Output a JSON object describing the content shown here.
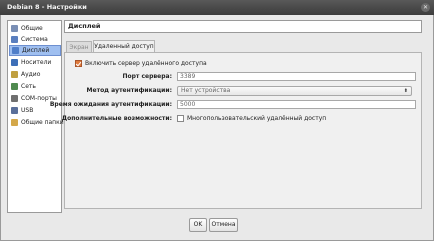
{
  "window": {
    "title": "Debian 8 - Настройки"
  },
  "sidebar": {
    "items": [
      {
        "label": "Общие",
        "icon": "general-icon",
        "color": "#7a8fb5"
      },
      {
        "label": "Система",
        "icon": "system-icon",
        "color": "#5a7fbf"
      },
      {
        "label": "Дисплей",
        "icon": "display-icon",
        "color": "#4f7ec9",
        "active": true
      },
      {
        "label": "Носители",
        "icon": "storage-icon",
        "color": "#3d6fb8"
      },
      {
        "label": "Аудио",
        "icon": "audio-icon",
        "color": "#c0a040"
      },
      {
        "label": "Сеть",
        "icon": "network-icon",
        "color": "#4f8a4f"
      },
      {
        "label": "COM-порты",
        "icon": "serial-port-icon",
        "color": "#6f6f6f"
      },
      {
        "label": "USB",
        "icon": "usb-icon",
        "color": "#5a6f9a"
      },
      {
        "label": "Общие папки",
        "icon": "shared-folder-icon",
        "color": "#d4a84a"
      }
    ]
  },
  "main": {
    "title": "Дисплей",
    "tabs": [
      {
        "label": "Экран"
      },
      {
        "label": "Удаленный доступ"
      }
    ],
    "remote": {
      "enable_label": "Включить сервер удалённого доступа",
      "port_label": "Порт сервера:",
      "port_value": "3389",
      "auth_label": "Метод аутентификации:",
      "auth_value": "Нет устройства",
      "timeout_label": "Время ожидания аутентификации:",
      "timeout_value": "5000",
      "extra_label": "Дополнительные возможности:",
      "multiuser_label": "Многопользовательский удалённый доступ"
    }
  },
  "footer": {
    "ok": "OK",
    "cancel": "Отмена"
  }
}
